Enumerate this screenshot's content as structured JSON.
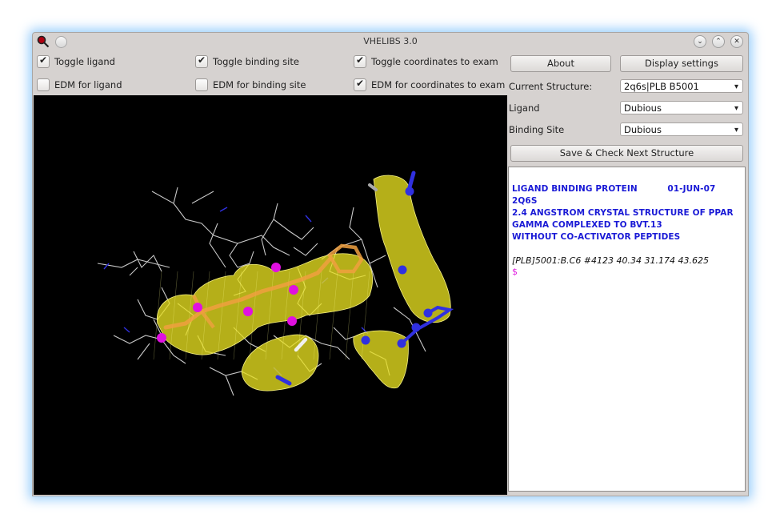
{
  "window": {
    "title": "VHELIBS 3.0",
    "controls": [
      "minimize",
      "maximize",
      "close"
    ]
  },
  "checkboxes": [
    {
      "label": "Toggle ligand",
      "checked": true
    },
    {
      "label": "Toggle binding site",
      "checked": true
    },
    {
      "label": "Toggle coordinates to exam",
      "checked": true
    },
    {
      "label": "EDM for ligand",
      "checked": false
    },
    {
      "label": "EDM for binding site",
      "checked": false
    },
    {
      "label": "EDM for coordinates to exam",
      "checked": true
    }
  ],
  "buttons": {
    "about": "About",
    "display_settings": "Display settings",
    "save_next": "Save & Check Next Structure"
  },
  "fields": {
    "current_structure_label": "Current Structure:",
    "current_structure_value": "2q6s|PLB B5001",
    "ligand_label": "Ligand",
    "ligand_value": "Dubious",
    "binding_site_label": "Binding Site",
    "binding_site_value": "Dubious"
  },
  "console": {
    "header_lines": [
      "LIGAND BINDING PROTEIN          01-JUN-07",
      "2Q6S",
      "2.4 ANGSTROM CRYSTAL STRUCTURE OF PPAR",
      "GAMMA COMPLEXED TO BVT.13",
      "WITHOUT CO-ACTIVATOR PEPTIDES"
    ],
    "atom_info": "[PLB]5001:B.C6 #4123 40.34 31.174 43.625",
    "prompt": "$"
  },
  "colors": {
    "header_text": "#1a1ad6",
    "prompt": "#e020e0",
    "density_mesh": "#e8e020",
    "ligand": "#f0a040",
    "nitrogen": "#3030e0",
    "oxygen_sphere": "#e010e0",
    "bond": "#c8c8c8"
  }
}
